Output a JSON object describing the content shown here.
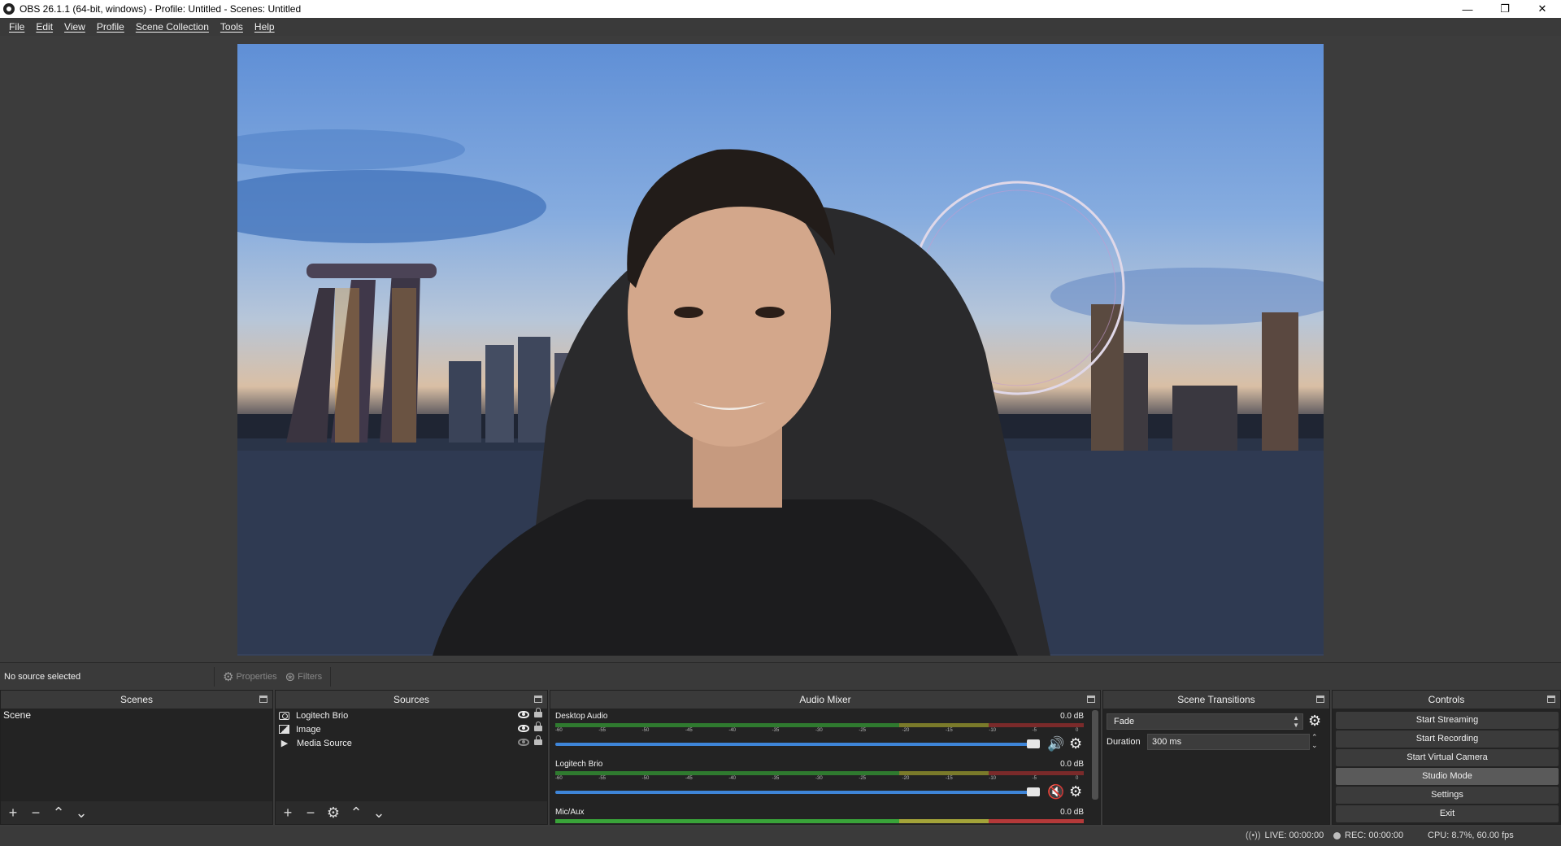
{
  "window": {
    "title": "OBS 26.1.1 (64-bit, windows) - Profile: Untitled - Scenes: Untitled",
    "controls": {
      "minimize": "—",
      "restore": "❐",
      "close": "✕"
    }
  },
  "menu": [
    "File",
    "Edit",
    "View",
    "Profile",
    "Scene Collection",
    "Tools",
    "Help"
  ],
  "source_toolbar": {
    "status": "No source selected",
    "properties_label": "Properties",
    "filters_label": "Filters"
  },
  "scenes": {
    "title": "Scenes",
    "items": [
      "Scene"
    ]
  },
  "sources": {
    "title": "Sources",
    "items": [
      {
        "name": "Logitech Brio",
        "icon": "camera-icon",
        "visible": true
      },
      {
        "name": "Image",
        "icon": "image-icon",
        "visible": true
      },
      {
        "name": "Media Source",
        "icon": "play-icon",
        "visible": false
      }
    ]
  },
  "mixer": {
    "title": "Audio Mixer",
    "ticks": [
      "-60",
      "-55",
      "-50",
      "-45",
      "-40",
      "-35",
      "-30",
      "-25",
      "-20",
      "-15",
      "-10",
      "-5",
      "0"
    ],
    "channels": [
      {
        "name": "Desktop Audio",
        "db": "0.0 dB",
        "muted": false,
        "volume": 1.0
      },
      {
        "name": "Logitech Brio",
        "db": "0.0 dB",
        "muted": true,
        "volume": 1.0
      },
      {
        "name": "Mic/Aux",
        "db": "0.0 dB",
        "muted": false,
        "volume": 1.0
      }
    ]
  },
  "transitions": {
    "title": "Scene Transitions",
    "selected": "Fade",
    "duration_label": "Duration",
    "duration_value": "300 ms"
  },
  "controls": {
    "title": "Controls",
    "buttons": [
      "Start Streaming",
      "Start Recording",
      "Start Virtual Camera",
      "Studio Mode",
      "Settings",
      "Exit"
    ]
  },
  "status": {
    "live": "LIVE: 00:00:00",
    "rec": "REC: 00:00:00",
    "cpu": "CPU: 8.7%, 60.00 fps"
  },
  "colors": {
    "fader": "#3e85d8",
    "meter_green": "#2f7a2f",
    "meter_yellow": "#7a7a2a",
    "meter_red": "#7a2a2a",
    "muted": "#e23030"
  }
}
